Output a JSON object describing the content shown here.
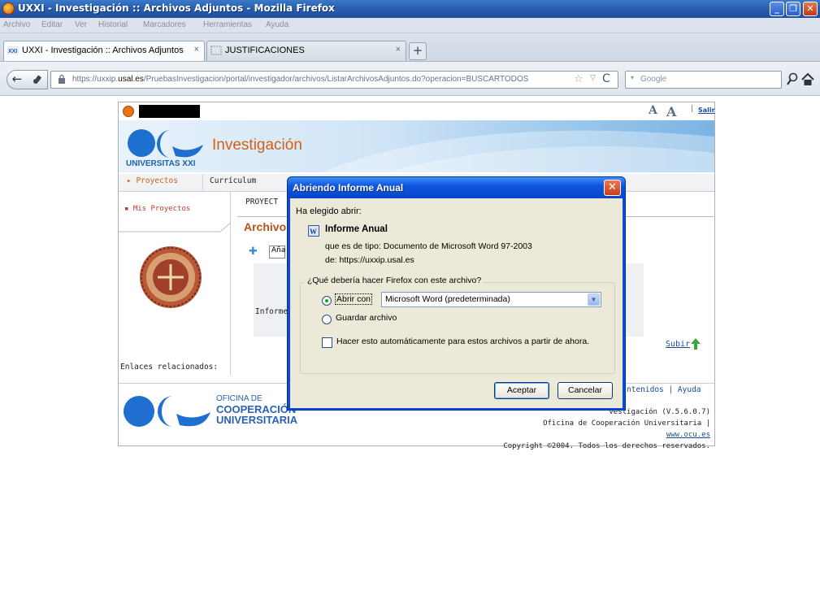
{
  "window": {
    "title": "UXXI - Investigación :: Archivos Adjuntos - Mozilla Firefox",
    "min": "_",
    "max": "❐",
    "close": "✕"
  },
  "menu": [
    "Archivo",
    "Editar",
    "Ver",
    "Historial",
    "Marcadores",
    "Herramientas",
    "Ayuda"
  ],
  "tabs": [
    {
      "label": "UXXI - Investigación :: Archivos Adjuntos",
      "close": "×"
    },
    {
      "label": "JUSTIFICACIONES",
      "close": "×"
    }
  ],
  "newtab": "+",
  "nav": {
    "back": "←",
    "url_pre": "https://uxxip.",
    "url_host": "usal.es",
    "url_post": "/PruebasInvestigacion/portal/investigador/archivos/ListarArchivosAdjuntos.do?operacion=BUSCARTODOS",
    "star": "☆",
    "drop": "▽",
    "reload": "C",
    "search_placeholder": "Google"
  },
  "page": {
    "salir": "Salir",
    "font_a1": "A",
    "font_a2": "A",
    "investigacion": "Investigación",
    "universitas": "UNIVERSITAS XXI",
    "tab_proyectos": "▸ Proyectos",
    "tab_curriculum": "Currículum",
    "mis_proyectos": "▪ Mis Proyectos",
    "proyect": "PROYECT",
    "archivo_title": "Archivo",
    "ana": "Aña",
    "informe": "Informe",
    "enlaces": "Enlaces relacionados:",
    "subir": "Subir",
    "footer_links": "ntenidos | Ayuda",
    "ocu_l1": "OFICINA DE",
    "ocu_l2": "COOPERACIÓN",
    "ocu_l3": "UNIVERSITARIA",
    "version": "vestigación (V.5.6.0.7)",
    "oficina_line": "Oficina de Cooperación Universitaria | ",
    "oficina_link": "www.ocu.es",
    "copyright": "Copyright ©2004. Todos los derechos reservados."
  },
  "dialog": {
    "title": "Abriendo Informe Anual",
    "close": "✕",
    "elegido": "Ha elegido abrir:",
    "filename": "Informe Anual",
    "tipo": "que es de tipo:  Documento de Microsoft Word 97-2003",
    "de": "de:  https://uxxip.usal.es",
    "pregunta": "¿Qué debería hacer Firefox con este archivo?",
    "abrir_con": "Abrir con",
    "app_selected": "Microsoft Word (predeterminada)",
    "guardar": "Guardar archivo",
    "auto": "Hacer esto automáticamente para estos archivos a partir de ahora.",
    "aceptar": "Aceptar",
    "cancelar": "Cancelar"
  }
}
